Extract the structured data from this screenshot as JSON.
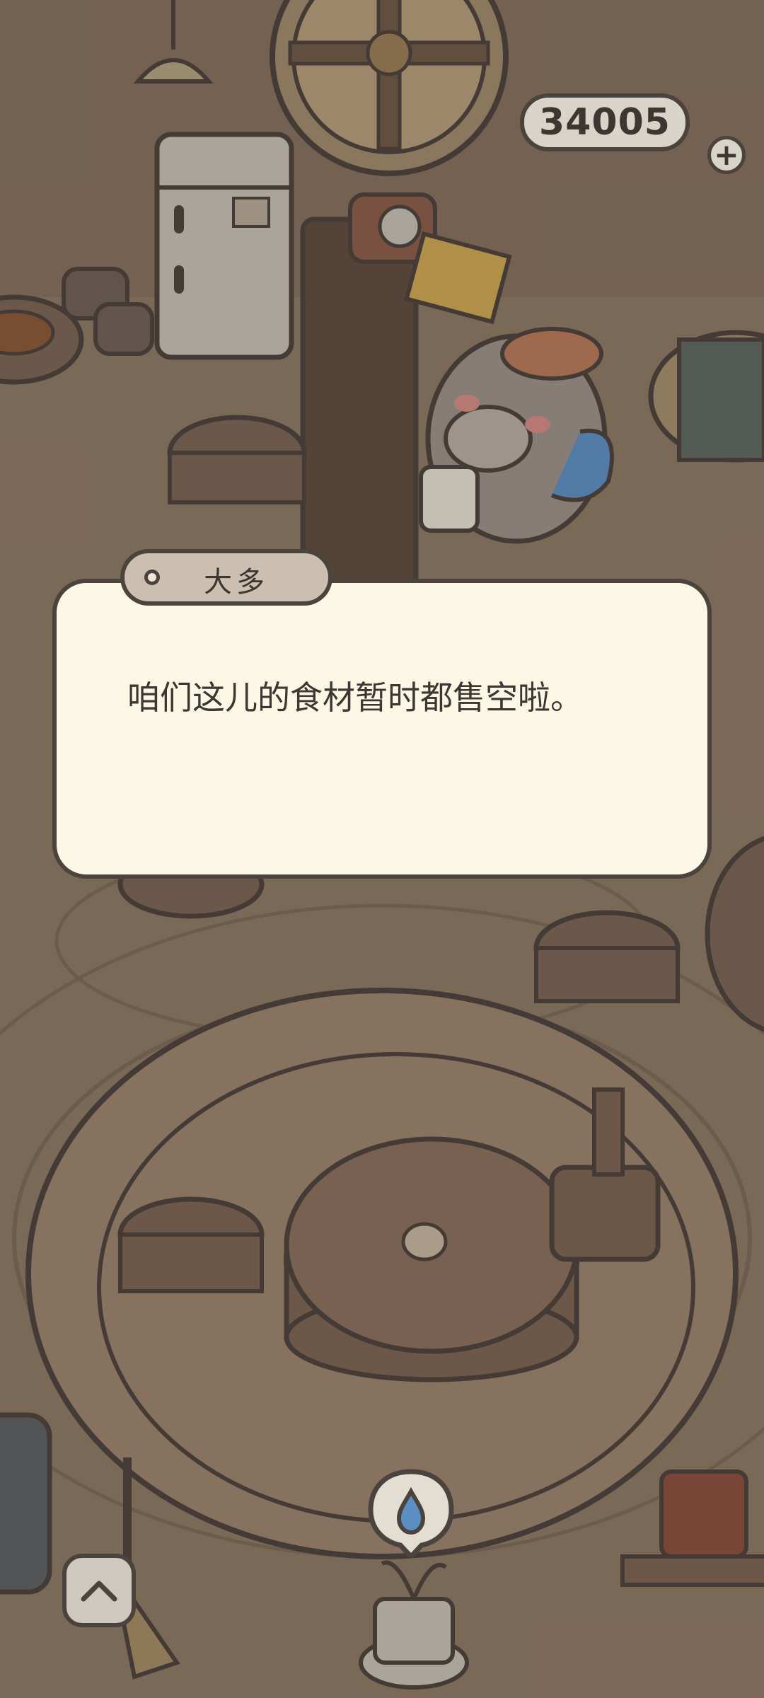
{
  "currency": {
    "amount": "34005",
    "add_icon": "plus-icon"
  },
  "dialog": {
    "speaker": "大多",
    "text": "咱们这儿的食材暂时都售空啦。"
  },
  "controls": {
    "expand_icon": "chevron-up-icon",
    "water_icon": "water-drop-icon"
  },
  "colors": {
    "outline": "#4b433d",
    "dialog_bg": "#fdf8e5",
    "floor": "#8e7a66",
    "nametag_bg": "#cbbfb0"
  }
}
